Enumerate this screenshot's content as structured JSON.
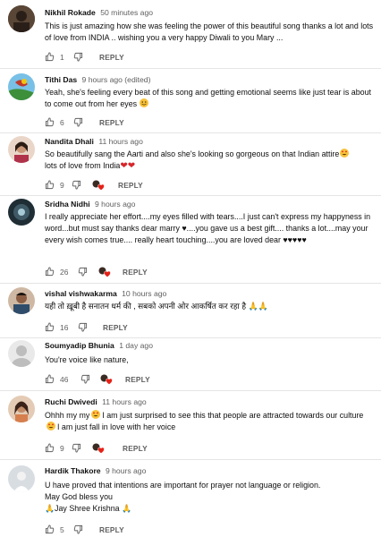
{
  "comments": [
    {
      "author": "Nikhil Rokade",
      "time": "50 minutes ago",
      "text": "This is just amazing how she was feeling the power of this beautiful song thanks a lot and lots of love from INDIA .. wishing you a very happy Diwali to you Mary ...",
      "likes": "1",
      "reply": "REPLY",
      "avatar_color": "#4a3b2e"
    },
    {
      "author": "Tithi Das",
      "time": "9 hours ago (edited)",
      "text": "Yeah, she's feeling every beat of this song and getting emotional seems like just tear is about to come out from her eyes",
      "likes": "6",
      "reply": "REPLY",
      "avatar_color": "#5ea3c8"
    },
    {
      "author": "Nandita Dhali",
      "time": "11 hours ago",
      "text": "So beautifully sang the Aarti and also she's looking so gorgeous on that Indian attire",
      "text2": "lots of love from India",
      "likes": "9",
      "reply": "REPLY",
      "avatar_color": "#b07a5a"
    },
    {
      "author": "Sridha Nidhi",
      "time": "9 hours ago",
      "text": "I really appreciate her effort....my eyes filled with tears....I just can't express my happyness in word...but must say thanks dear marry ♥....you gave us a best gift.... thanks a lot....may your every wish comes true.... really heart touching....you are loved dear ♥♥♥♥♥",
      "likes": "26",
      "reply": "REPLY",
      "avatar_color": "#2c3a44"
    },
    {
      "author": "vishal vishwakarma",
      "time": "10 hours ago",
      "text": "यही तो ख़ूबी है सनातन धर्म की , सबको अपनी ओर आकर्षित कर रहा है 🙏🙏",
      "likes": "16",
      "reply": "REPLY",
      "avatar_color": "#6e4a3a"
    },
    {
      "author": "Soumyadip Bhunia",
      "time": "1 day ago",
      "text": "You're voice like nature,",
      "likes": "46",
      "reply": "REPLY",
      "avatar_color": "#e8e8e8"
    },
    {
      "author": "Ruchi Dwivedi",
      "time": "11 hours ago",
      "text": "Ohhh my my",
      "text_b": "I am just surprised to see this that people are attracted towards our culture",
      "text_c": "I am just fall in love with her voice",
      "likes": "9",
      "reply": "REPLY",
      "avatar_color": "#a5724f"
    },
    {
      "author": "Hardik Thakore",
      "time": "9 hours ago",
      "text": "U have proved that intentions are important for prayer not language or religion.",
      "text2": "May God bless you",
      "text3": "🙏Jay Shree Krishna 🙏",
      "likes": "5",
      "reply": "REPLY",
      "avatar_color": "#c9c9c9"
    }
  ],
  "colors": {
    "author": "#0f0f0f",
    "meta": "#606060",
    "heart": "#d6262c",
    "divider": "#e5e5e5"
  },
  "icons": [
    "thumb-up-icon",
    "thumb-down-icon",
    "creator-heart-icon",
    "smile-emoji-icon",
    "heart-eyes-emoji-icon",
    "red-heart-emoji-icon",
    "folded-hands-emoji-icon"
  ]
}
